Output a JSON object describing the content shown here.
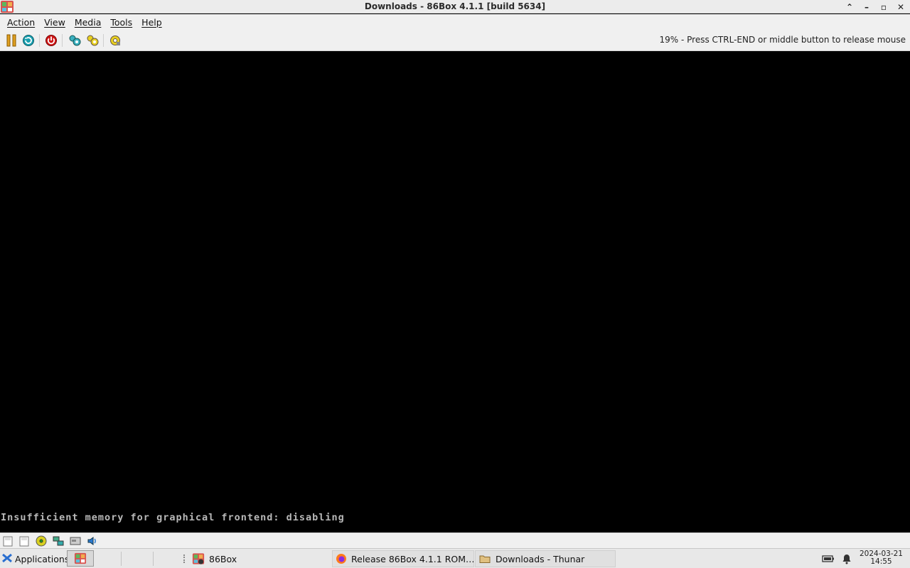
{
  "window": {
    "title": "Downloads - 86Box 4.1.1 [build 5634]",
    "icon": "86box-icon",
    "controls": [
      "chevron-up-icon",
      "minimize-icon",
      "maximize-icon",
      "close-icon"
    ]
  },
  "menu": {
    "items": [
      "Action",
      "View",
      "Media",
      "Tools",
      "Help"
    ]
  },
  "toolbar": {
    "buttons": [
      "pause-icon",
      "reset-icon",
      "power-icon",
      "ctrl-alt-del-icon",
      "ctrl-alt-esc-icon",
      "settings-icon"
    ],
    "status_message": "19% - Press CTRL-END or middle button to release mouse"
  },
  "screen": {
    "text": "Insufficient memory for graphical frontend: disabling"
  },
  "statusbar": {
    "icons": [
      "floppy-a-icon",
      "floppy-b-icon",
      "cdrom-icon",
      "network-icon",
      "hdd-icon",
      "sound-icon"
    ]
  },
  "taskbar": {
    "applications_label": "Applications",
    "tasks": [
      {
        "label": "86Box",
        "icon": "86box-icon"
      },
      {
        "label": "Release 86Box 4.1.1 ROM…",
        "icon": "firefox-icon"
      },
      {
        "label": "Downloads - Thunar",
        "icon": "folder-icon"
      }
    ],
    "tray": [
      "battery-icon",
      "bell-icon"
    ],
    "date": "2024-03-21",
    "time": "14:55"
  },
  "colors": {
    "screen_bg": "#000000",
    "chrome_bg": "#f0f0f0",
    "screen_text": "#b8b8b8"
  }
}
